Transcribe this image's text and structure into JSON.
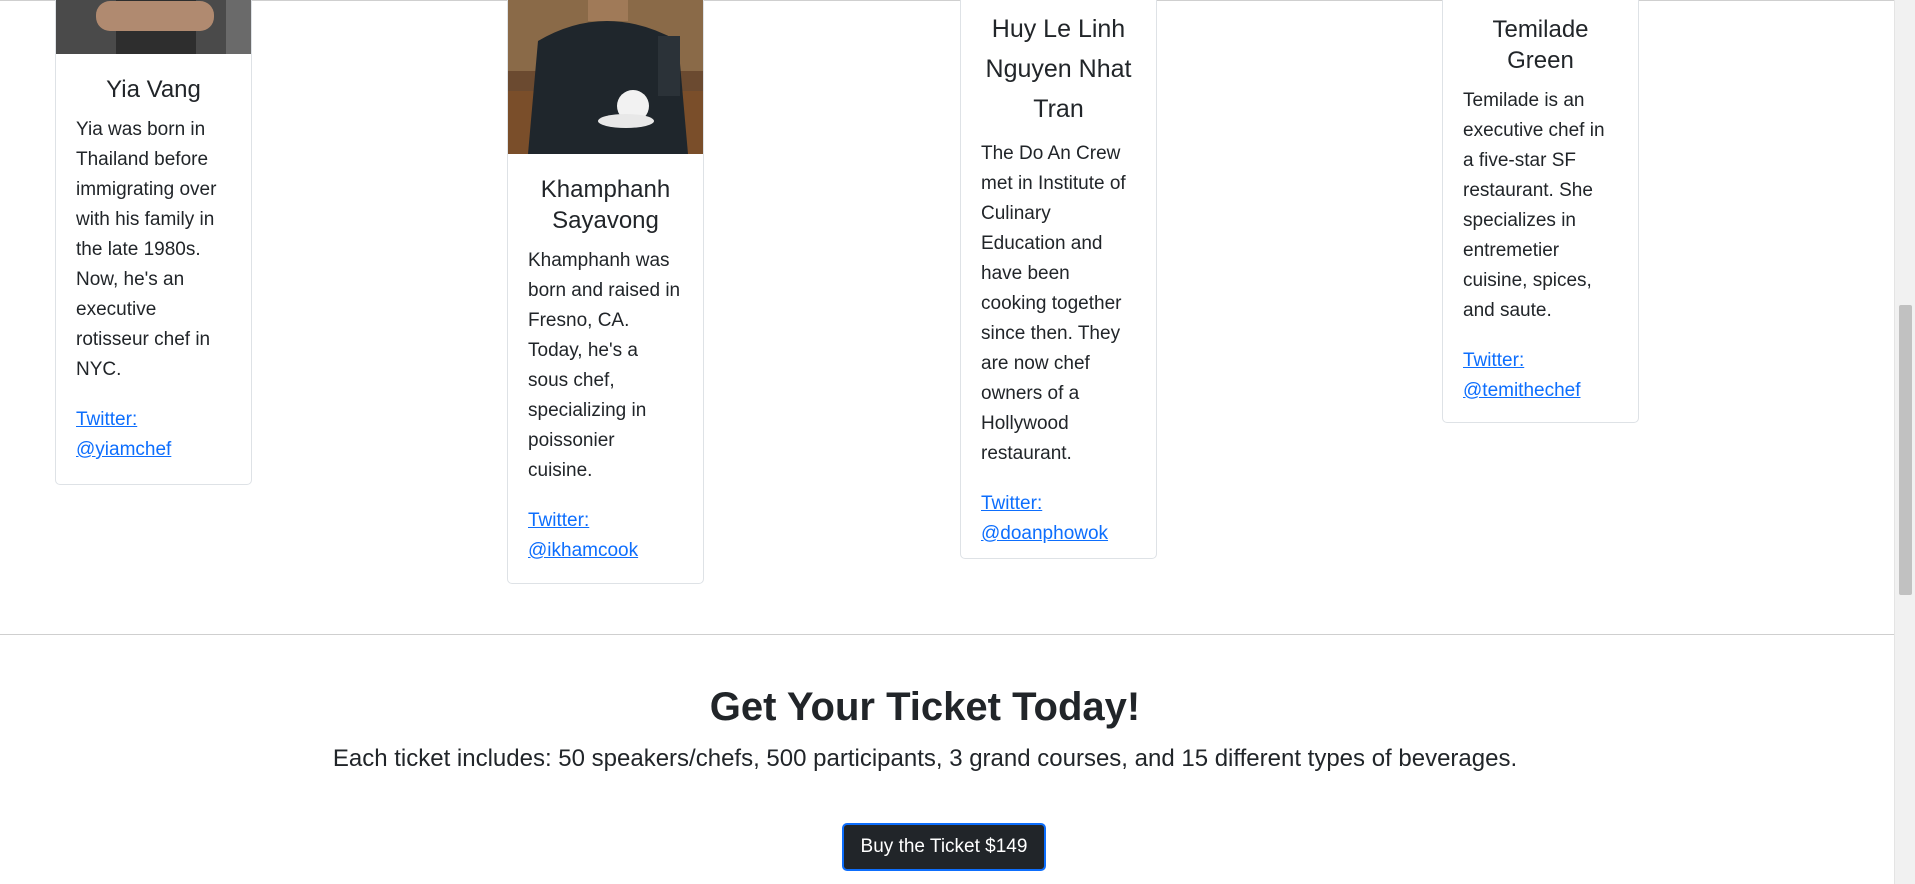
{
  "speakers": [
    {
      "name": "Yia Vang",
      "bio": "Yia was born in Thailand before immigrating over with his family in the late 1980s. Now, he's an executive rotisseur chef in NYC.",
      "twitter": "Twitter: @yiamchef"
    },
    {
      "name": "Khamphanh Sayavong",
      "bio": "Khamphanh was born and raised in Fresno, CA. Today, he's a sous chef, specializing in poissonier cuisine.",
      "twitter": "Twitter: @ikhamcook"
    },
    {
      "name": "Huy Le Linh Nguyen Nhat Tran",
      "bio": "The Do An Crew met in Institute of Culinary Education and have been cooking together since then. They are now chef owners of a Hollywood restaurant.",
      "twitter": "Twitter: @doanphowok"
    },
    {
      "name": "Temilade Green",
      "bio": "Temilade is an executive chef in a five-star SF restaurant. She specializes in entremetier cuisine, spices, and saute.",
      "twitter": "Twitter: @temithechef"
    }
  ],
  "ticket": {
    "title": "Get Your Ticket Today!",
    "description": "Each ticket includes: 50 speakers/chefs, 500 participants, 3 grand courses, and 15 different types of beverages.",
    "button_label": "Buy the Ticket $149"
  },
  "colors": {
    "link": "#0d6efd",
    "button_bg": "#212529",
    "text": "#212529"
  }
}
